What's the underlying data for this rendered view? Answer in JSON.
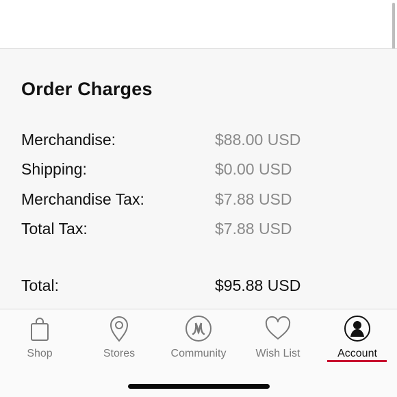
{
  "order_charges": {
    "title": "Order Charges",
    "rows": [
      {
        "label": "Merchandise:",
        "value": "$88.00 USD"
      },
      {
        "label": "Shipping:",
        "value": "$0.00 USD"
      },
      {
        "label": "Merchandise Tax:",
        "value": "$7.88 USD"
      },
      {
        "label": "Total Tax:",
        "value": "$7.88 USD"
      }
    ],
    "total": {
      "label": "Total:",
      "value": "$95.88 USD"
    }
  },
  "tab_bar": {
    "tabs": [
      {
        "label": "Shop",
        "icon": "shopping-bag-icon",
        "active": false
      },
      {
        "label": "Stores",
        "icon": "map-pin-icon",
        "active": false
      },
      {
        "label": "Community",
        "icon": "lululemon-logo-icon",
        "active": false
      },
      {
        "label": "Wish List",
        "icon": "heart-icon",
        "active": false
      },
      {
        "label": "Account",
        "icon": "account-icon",
        "active": true
      }
    ],
    "active_color": "#c8102e"
  }
}
